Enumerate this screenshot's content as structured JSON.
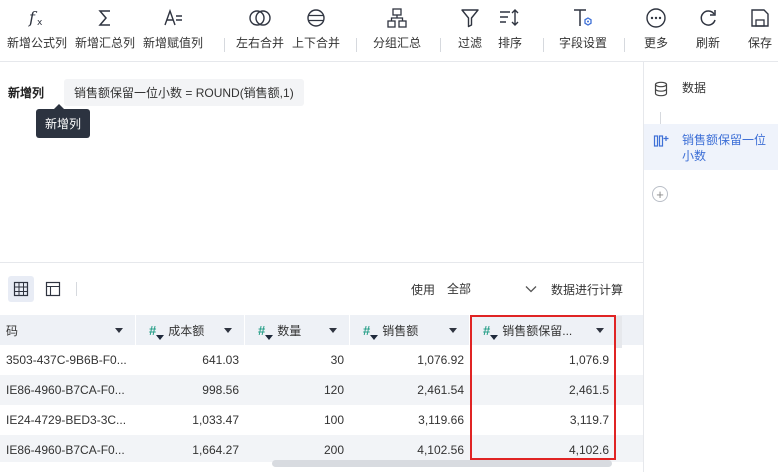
{
  "toolbar": {
    "items": [
      {
        "label": "新增公式列",
        "icon": "formula-icon"
      },
      {
        "label": "新增汇总列",
        "icon": "sigma-icon"
      },
      {
        "label": "新增赋值列",
        "icon": "assign-icon"
      },
      {
        "label": "左右合并",
        "icon": "merge-horizontal-icon"
      },
      {
        "label": "上下合并",
        "icon": "merge-vertical-icon"
      },
      {
        "label": "分组汇总",
        "icon": "group-summary-icon"
      },
      {
        "label": "过滤",
        "icon": "filter-icon"
      },
      {
        "label": "排序",
        "icon": "sort-icon"
      },
      {
        "label": "字段设置",
        "icon": "field-settings-icon"
      },
      {
        "label": "更多",
        "icon": "more-icon"
      },
      {
        "label": "刷新",
        "icon": "refresh-icon"
      },
      {
        "label": "保存",
        "icon": "save-icon"
      }
    ]
  },
  "formula": {
    "title": "新增列",
    "expression": "销售额保留一位小数 = ROUND(销售额,1)",
    "tooltip": "新增列"
  },
  "calc": {
    "use_label": "使用",
    "select_value": "全部",
    "suffix": "数据进行计算"
  },
  "table": {
    "columns": [
      {
        "name": "码",
        "type": "text"
      },
      {
        "name": "成本额",
        "type": "number"
      },
      {
        "name": "数量",
        "type": "number"
      },
      {
        "name": "销售额",
        "type": "number"
      },
      {
        "name": "销售额保留...",
        "type": "number"
      }
    ],
    "rows": [
      [
        "3503-437C-9B6B-F0...",
        "641.03",
        "30",
        "1,076.92",
        "1,076.9"
      ],
      [
        "IE86-4960-B7CA-F0...",
        "998.56",
        "120",
        "2,461.54",
        "2,461.5"
      ],
      [
        "IE24-4729-BED3-3C...",
        "1,033.47",
        "100",
        "3,119.66",
        "3,119.7"
      ],
      [
        "IE86-4960-B7CA-F0...",
        "1,664.27",
        "200",
        "4,102.56",
        "4,102.6"
      ]
    ]
  },
  "sidebar": {
    "items": [
      {
        "label": "数据",
        "icon": "database-icon"
      },
      {
        "label": "销售额保留一位小数",
        "icon": "add-column-icon"
      }
    ],
    "add_label": "+"
  },
  "colors": {
    "accent": "#3d6fd6",
    "highlight": "#e02424",
    "number_type": "#2aa08a"
  }
}
